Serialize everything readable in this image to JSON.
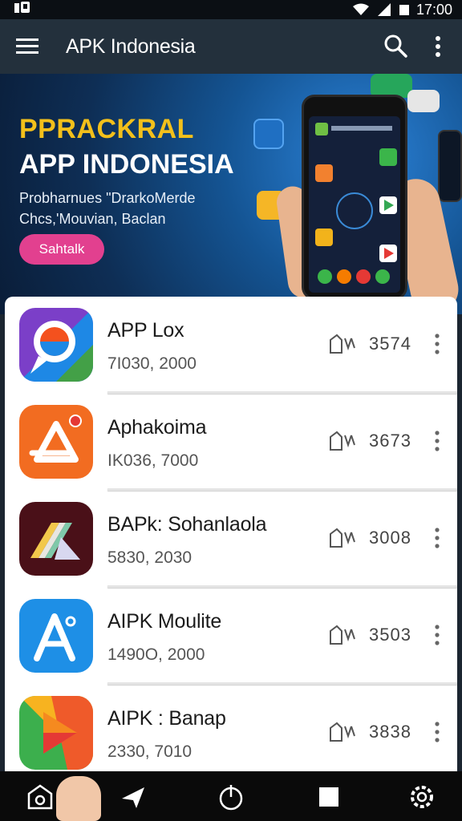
{
  "status_bar": {
    "time": "17:00"
  },
  "app_bar": {
    "title": "APK Indonesia",
    "menu_icon": "hamburger-menu-icon",
    "search_icon": "search-icon",
    "more_icon": "more-vert-icon"
  },
  "banner": {
    "headline_top": "PPRACKRAL",
    "headline_bottom": "APP INDONESIA",
    "description_line1": "Probharnues \"DrarkoMerde",
    "description_line2": "Chcs,'Mouvian, Baclan",
    "cta_label": "Sahtalk",
    "colors": {
      "headline": "#f3c01b",
      "cta": "#e2408f"
    }
  },
  "apps": [
    {
      "name": "APP Lox",
      "meta": "7I030, 2000",
      "count": "3574",
      "icon": "magnifier-app-icon"
    },
    {
      "name": "Aphakoima",
      "meta": "IK036, 7000",
      "count": "3673",
      "icon": "triangle-app-icon"
    },
    {
      "name": "BAPk: Sohanlaola",
      "meta": "5830, 2030",
      "count": "3008",
      "icon": "stripes-app-icon"
    },
    {
      "name": "AIPK Moulite",
      "meta": "1490O, 2000",
      "count": "3503",
      "icon": "a-letter-app-icon"
    },
    {
      "name": "AIPK : Banap",
      "meta": "2330, 7010",
      "count": "3838",
      "icon": "play-app-icon"
    }
  ],
  "bottom_nav": {
    "items": [
      "home-icon",
      "send-icon",
      "power-icon",
      "stop-icon",
      "settings-icon"
    ]
  }
}
